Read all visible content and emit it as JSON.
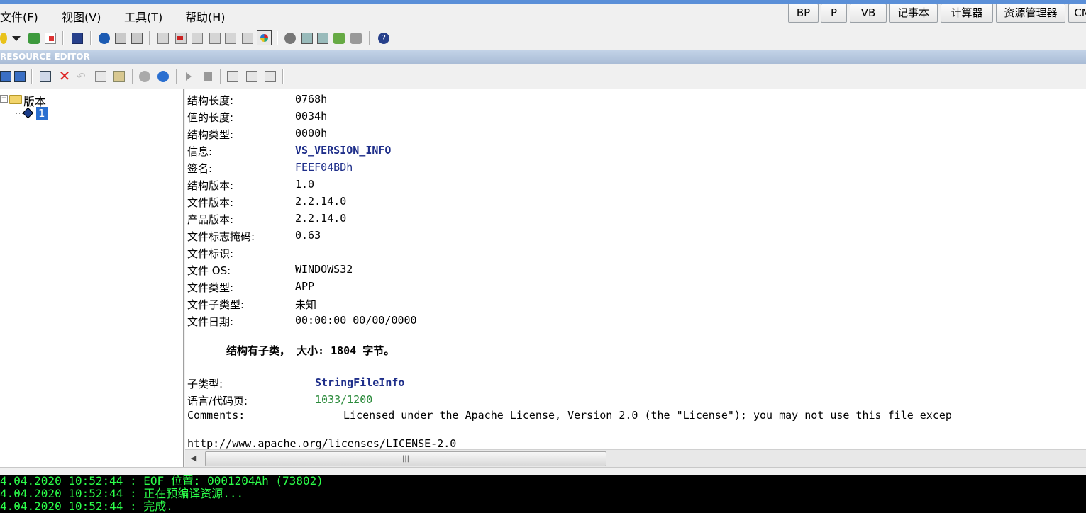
{
  "menu": {
    "file": "文件(F)",
    "view": "视图(V)",
    "tools": "工具(T)",
    "help": "帮助(H)"
  },
  "quick_buttons": [
    "BP",
    "P",
    "VB",
    "记事本",
    "计算器",
    "资源管理器",
    "CM"
  ],
  "resource_editor_title": "RESOURCE EDITOR",
  "tree": {
    "root_label": "版本",
    "child_label": "1"
  },
  "fields": [
    {
      "label": "结构长度:",
      "value": "0768h"
    },
    {
      "label": "值的长度:",
      "value": "0034h"
    },
    {
      "label": "结构类型:",
      "value": "0000h"
    },
    {
      "label": "信息:",
      "value": "VS_VERSION_INFO"
    },
    {
      "label": "签名:",
      "value": "FEEF04BDh"
    },
    {
      "label": "结构版本:",
      "value": "1.0"
    },
    {
      "label": "文件版本:",
      "value": "2.2.14.0"
    },
    {
      "label": "产品版本:",
      "value": "2.2.14.0"
    },
    {
      "label": "文件标志掩码:",
      "value": "0.63"
    },
    {
      "label": "文件标识:",
      "value": ""
    },
    {
      "label": "文件 OS:",
      "value": "WINDOWS32"
    },
    {
      "label": "文件类型:",
      "value": "APP"
    },
    {
      "label": "文件子类型:",
      "value": "未知"
    },
    {
      "label": "文件日期:",
      "value": "00:00:00  00/00/0000"
    }
  ],
  "summary": "结构有子类， 大小: 1804 字节。",
  "subtype": {
    "label": "子类型:",
    "value": "StringFileInfo",
    "lang_label": "语言/代码页:",
    "lang_value": "1033/1200",
    "comments_label": "Comments:",
    "comments_value": "Licensed under the Apache License, Version 2.0 (the \"License\"); you may not use this file excep",
    "url": "http://www.apache.org/licenses/LICENSE-2.0"
  },
  "console": [
    "4.04.2020 10:52:44 : EOF 位置: 0001204Ah  (73802)",
    "4.04.2020 10:52:44 : 正在预编译资源...",
    "4.04.2020 10:52:44 : 完成."
  ],
  "colors": {
    "accent": "#5a8fd8",
    "console_text": "#2cff4a",
    "value_blue": "#1f2f8a",
    "value_green": "#2a8a3a"
  }
}
